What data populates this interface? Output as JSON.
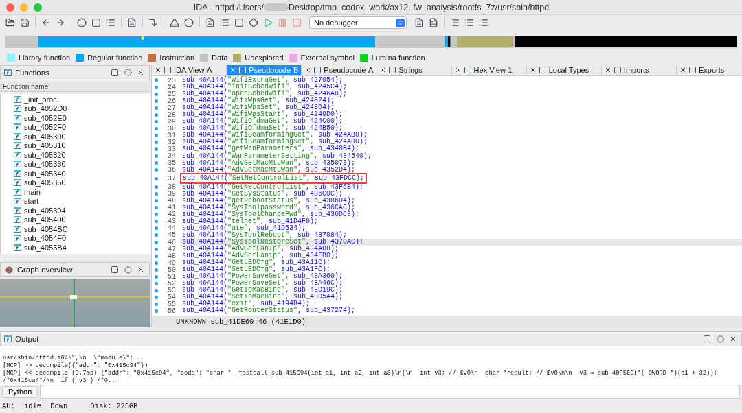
{
  "window": {
    "title_start": "IDA - httpd /Users/",
    "title_end": "Desktop/tmp_codex_work/ax12_fw_analysis/rootfs_7z/usr/sbin/httpd"
  },
  "toolbar": {
    "debugger": "No debugger"
  },
  "legend": [
    {
      "label": "Library function",
      "color": "#8ef3fb"
    },
    {
      "label": "Regular function",
      "color": "#0aa6ee"
    },
    {
      "label": "Instruction",
      "color": "#c0714a"
    },
    {
      "label": "Data",
      "color": "#c0c0c0"
    },
    {
      "label": "Unexplored",
      "color": "#b3b06a"
    },
    {
      "label": "External symbol",
      "color": "#f9a3ef"
    },
    {
      "label": "Lumina function",
      "color": "#10d21a"
    }
  ],
  "functions": {
    "title": "Functions",
    "column": "Function name",
    "items": [
      {
        "name": "_init_proc",
        "selected": false
      },
      {
        "name": "sub_4052D0",
        "selected": false
      },
      {
        "name": "sub_4052E0",
        "selected": false
      },
      {
        "name": "sub_4052F0",
        "selected": false
      },
      {
        "name": "sub_405300",
        "selected": false
      },
      {
        "name": "sub_405310",
        "selected": false
      },
      {
        "name": "sub_405320",
        "selected": false
      },
      {
        "name": "sub_405330",
        "selected": false
      },
      {
        "name": "sub_405340",
        "selected": false
      },
      {
        "name": "sub_405350",
        "selected": false
      },
      {
        "name": "main",
        "selected": false
      },
      {
        "name": "start",
        "selected": false
      },
      {
        "name": "sub_405394",
        "selected": false
      },
      {
        "name": "sub_405400",
        "selected": false
      },
      {
        "name": "sub_4054BC",
        "selected": false
      },
      {
        "name": "sub_4054F0",
        "selected": false
      },
      {
        "name": "sub_4055B4",
        "selected": false
      }
    ]
  },
  "graph_overview": {
    "title": "Graph overview"
  },
  "tabs": [
    {
      "label": "IDA View-A",
      "selected": false
    },
    {
      "label": "Pseudocode-B",
      "selected": true
    },
    {
      "label": "Pseudocode-A",
      "selected": false
    },
    {
      "label": "Strings",
      "selected": false
    },
    {
      "label": "Hex View-1",
      "selected": false
    },
    {
      "label": "Local Types",
      "selected": false
    },
    {
      "label": "Imports",
      "selected": false
    },
    {
      "label": "Exports",
      "selected": false
    }
  ],
  "code": {
    "lines": [
      {
        "number": "23",
        "head": "sub_40A144(",
        "string": "\"WifiExtraGet\"",
        "tail": ", sub_427054);",
        "boxed": false,
        "current": false
      },
      {
        "number": "24",
        "head": "sub_40A144(",
        "string": "\"initSchedWifi\"",
        "tail": ", sub_4245C4);",
        "boxed": false,
        "current": false
      },
      {
        "number": "25",
        "head": "sub_40A144(",
        "string": "\"openSchedWifi\"",
        "tail": ", sub_4246A0);",
        "boxed": false,
        "current": false
      },
      {
        "number": "26",
        "head": "sub_40A144(",
        "string": "\"WifiWpsGet\"",
        "tail": ", sub_424824);",
        "boxed": false,
        "current": false
      },
      {
        "number": "27",
        "head": "sub_40A144(",
        "string": "\"WifiWpsSet\"",
        "tail": ", sub_4248D4);",
        "boxed": false,
        "current": false
      },
      {
        "number": "28",
        "head": "sub_40A144(",
        "string": "\"WifiWpsStart\"",
        "tail": ", sub_4249D0);",
        "boxed": false,
        "current": false
      },
      {
        "number": "29",
        "head": "sub_40A144(",
        "string": "\"WifiOfdmaGet\"",
        "tail": ", sub_424C00);",
        "boxed": false,
        "current": false
      },
      {
        "number": "30",
        "head": "sub_40A144(",
        "string": "\"WifiOfdmaSet\"",
        "tail": ", sub_424B50);",
        "boxed": false,
        "current": false
      },
      {
        "number": "31",
        "head": "sub_40A144(",
        "string": "\"WifiBeamformingGet\"",
        "tail": ", sub_424AB0);",
        "boxed": false,
        "current": false
      },
      {
        "number": "32",
        "head": "sub_40A144(",
        "string": "\"WifiBeamformingSet\"",
        "tail": ", sub_424A00);",
        "boxed": false,
        "current": false
      },
      {
        "number": "33",
        "head": "sub_40A144(",
        "string": "\"getWanParameters\"",
        "tail": ", sub_4340B4);",
        "boxed": false,
        "current": false
      },
      {
        "number": "34",
        "head": "sub_40A144(",
        "string": "\"WanParameterSetting\"",
        "tail": ", sub_434540);",
        "boxed": false,
        "current": false
      },
      {
        "number": "35",
        "head": "sub_40A144(",
        "string": "\"AdvGetMacMtuWan\"",
        "tail": ", sub_435078);",
        "boxed": false,
        "current": false
      },
      {
        "number": "36",
        "head": "sub_40A144(",
        "string": "\"AdvSetMacMtuWan\"",
        "tail": ", sub_4352D4);",
        "boxed": false,
        "current": false
      },
      {
        "number": "37",
        "head": "sub_40A144(",
        "string": "\"SetNetControlList\"",
        "tail": ", sub_43FDCC);",
        "boxed": true,
        "current": false
      },
      {
        "number": "38",
        "head": "sub_40A144(",
        "string": "\"GetNetControlList\"",
        "tail": ", sub_43F6B4);",
        "boxed": false,
        "current": false
      },
      {
        "number": "39",
        "head": "sub_40A144(",
        "string": "\"GetSysStatus\"",
        "tail": ", sub_436C0C);",
        "boxed": false,
        "current": false
      },
      {
        "number": "40",
        "head": "sub_40A144(",
        "string": "\"getRebootStatus\"",
        "tail": ", sub_4386D4);",
        "boxed": false,
        "current": false
      },
      {
        "number": "41",
        "head": "sub_40A144(",
        "string": "\"SysToolpassword\"",
        "tail": ", sub_436CAC);",
        "boxed": false,
        "current": false
      },
      {
        "number": "42",
        "head": "sub_40A144(",
        "string": "\"SysToolChangePwd\"",
        "tail": ", sub_436DC8);",
        "boxed": false,
        "current": false
      },
      {
        "number": "43",
        "head": "sub_40A144(",
        "string": "\"telnet\"",
        "tail": ", sub_41D4F0);",
        "boxed": false,
        "current": false
      },
      {
        "number": "44",
        "head": "sub_40A144(",
        "string": "\"ate\"",
        "tail": ", sub_41D534);",
        "boxed": false,
        "current": false
      },
      {
        "number": "45",
        "head": "sub_40A144(",
        "string": "\"SysToolReboot\"",
        "tail": ", sub_437084);",
        "boxed": false,
        "current": false
      },
      {
        "number": "46",
        "head": "sub_40A144(",
        "string": "\"SysToolRestoreSet\"",
        "tail": ", sub_4370AC);",
        "boxed": false,
        "current": true
      },
      {
        "number": "47",
        "head": "sub_40A144(",
        "string": "\"AdvGetLanIp\"",
        "tail": ", sub_434AD8);",
        "boxed": false,
        "current": false
      },
      {
        "number": "48",
        "head": "sub_40A144(",
        "string": "\"AdvSetLanip\"",
        "tail": ", sub_434FB0);",
        "boxed": false,
        "current": false
      },
      {
        "number": "49",
        "head": "sub_40A144(",
        "string": "\"GetLEDCfg\"",
        "tail": ", sub_43A11C);",
        "boxed": false,
        "current": false
      },
      {
        "number": "50",
        "head": "sub_40A144(",
        "string": "\"SetLEDCfg\"",
        "tail": ", sub_43A1FC);",
        "boxed": false,
        "current": false
      },
      {
        "number": "51",
        "head": "sub_40A144(",
        "string": "\"PowerSaveGet\"",
        "tail": ", sub_43A360);",
        "boxed": false,
        "current": false
      },
      {
        "number": "52",
        "head": "sub_40A144(",
        "string": "\"PowerSaveSet\"",
        "tail": ", sub_43A46C);",
        "boxed": false,
        "current": false
      },
      {
        "number": "53",
        "head": "sub_40A144(",
        "string": "\"GetIpMacBind\"",
        "tail": ", sub_43D19C);",
        "boxed": false,
        "current": false
      },
      {
        "number": "54",
        "head": "sub_40A144(",
        "string": "\"SetIpMacBind\"",
        "tail": ", sub_43D5A4);",
        "boxed": false,
        "current": false
      },
      {
        "number": "55",
        "head": "sub_40A144(",
        "string": "\"exit\"",
        "tail": ", sub_4194B4);",
        "boxed": false,
        "current": false
      },
      {
        "number": "56",
        "head": "sub_40A144(",
        "string": "\"GetRouterStatus\"",
        "tail": ", sub_437274);",
        "boxed": false,
        "current": false
      }
    ],
    "status": "UNKNOWN sub_41DE60:46 (41E1D0)"
  },
  "output": {
    "title": "Output",
    "lines": [
      "usr/sbin/httpd.i64\\\",\\n  \\\"module\\\":...",
      "[MCP] >> decompile({\"addr\": \"0x415c94\"})",
      "[MCP] << decompile (9.7ms) {\"addr\": \"0x415c94\", \"code\": \"char *__fastcall sub_415C94(int a1, int a2, int a3)\\n{\\n  int v3; // $v0\\n  char *result; // $v0\\n\\n  v3 = sub_40F5EC(*(_DWORD *)(a1 + 32));",
      "/*0x415ca4*/\\n  if ( v3 ) /*0..."
    ],
    "language": "Python"
  },
  "status_bar": {
    "au_label": "AU:",
    "au_state": "idle",
    "direction": "Down",
    "disk": "Disk: 225GB"
  }
}
